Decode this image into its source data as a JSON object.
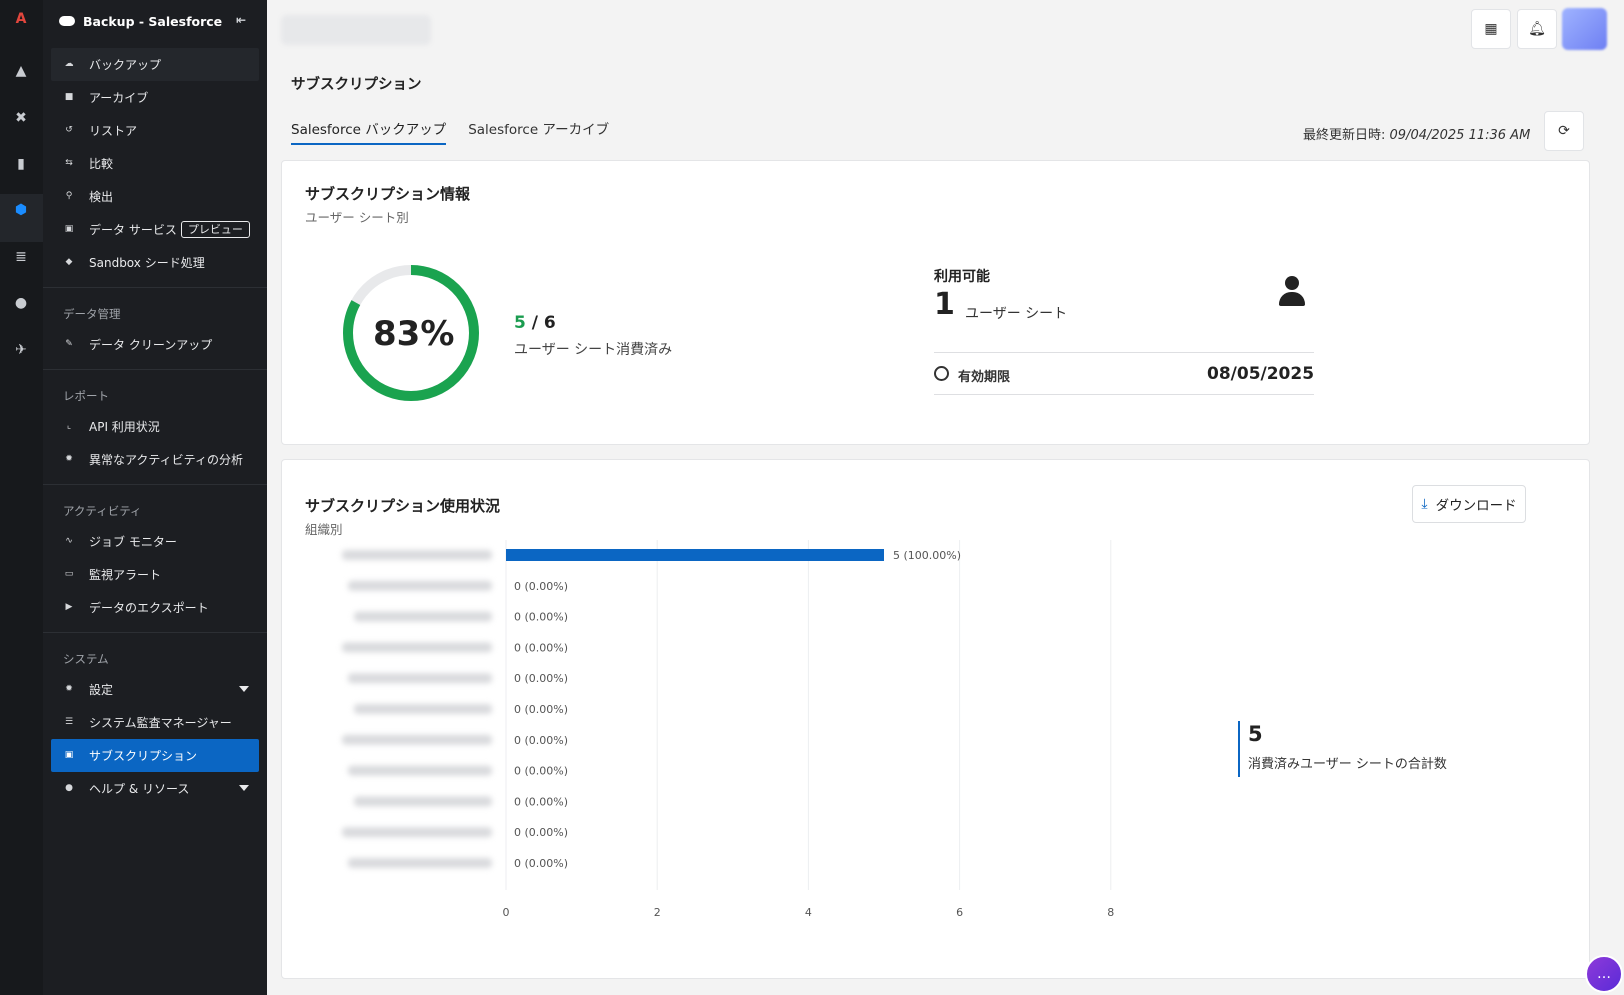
{
  "sidebar": {
    "header_title": "Backup - Salesforce",
    "items": [
      {
        "label": "バックアップ",
        "icon": "cloud-icon"
      },
      {
        "label": "アーカイブ",
        "icon": "archive-icon"
      },
      {
        "label": "リストア",
        "icon": "restore-icon"
      },
      {
        "label": "比較",
        "icon": "compare-icon"
      },
      {
        "label": "検出",
        "icon": "search-icon"
      },
      {
        "label": "データ サービス",
        "icon": "data-service-icon",
        "badge": "プレビュー"
      },
      {
        "label": "Sandbox シード処理",
        "icon": "sandbox-icon"
      }
    ],
    "sections": {
      "data_mgmt": {
        "title": "データ管理",
        "items": [
          {
            "label": "データ クリーンアップ"
          }
        ]
      },
      "reports": {
        "title": "レポート",
        "items": [
          {
            "label": "API 利用状況"
          },
          {
            "label": "異常なアクティビティの分析"
          }
        ]
      },
      "activity": {
        "title": "アクティビティ",
        "items": [
          {
            "label": "ジョブ モニター"
          },
          {
            "label": "監視アラート"
          },
          {
            "label": "データのエクスポート"
          }
        ]
      },
      "system": {
        "title": "システム",
        "items": [
          {
            "label": "設定"
          },
          {
            "label": "システム監査マネージャー"
          },
          {
            "label": "サブスクリプション"
          },
          {
            "label": "ヘルプ & リソース"
          }
        ]
      }
    }
  },
  "main": {
    "page_title": "サブスクリプション",
    "tabs": [
      {
        "label": "Salesforce バックアップ"
      },
      {
        "label": "Salesforce アーカイブ"
      }
    ],
    "last_updated_label": "最終更新日時: ",
    "last_updated_value": "09/04/2025 11:36 AM"
  },
  "info_card": {
    "title": "サブスクリプション情報",
    "subtitle": "ユーザー シート別",
    "percent_label": "83%",
    "percent_value": 83,
    "used": "5",
    "slash": " / ",
    "total": "6",
    "used_caption": "ユーザー シート消費済み",
    "available_title": "利用可能",
    "available_count": "1",
    "available_unit": "ユーザー シート",
    "expiry_label": "有効期限",
    "expiry_value": "08/05/2025"
  },
  "usage_card": {
    "title": "サブスクリプション使用状況",
    "subtitle": "組織別",
    "download_label": "ダウンロード",
    "total_value": "5",
    "total_caption": "消費済みユーザー シートの合計数"
  },
  "colors": {
    "accent": "#0b66c3",
    "green": "#1a9c4f",
    "bar": "#0b66c3"
  },
  "chart_data": {
    "type": "bar",
    "orientation": "horizontal",
    "categories": [
      "",
      "",
      "",
      "",
      "",
      "",
      "",
      "",
      "",
      "",
      ""
    ],
    "values": [
      5,
      0,
      0,
      0,
      0,
      0,
      0,
      0,
      0,
      0,
      0
    ],
    "data_labels": [
      "5 (100.00%)",
      "0 (0.00%)",
      "0 (0.00%)",
      "0 (0.00%)",
      "0 (0.00%)",
      "0 (0.00%)",
      "0 (0.00%)",
      "0 (0.00%)",
      "0 (0.00%)",
      "0 (0.00%)",
      "0 (0.00%)"
    ],
    "xlim": [
      0,
      8
    ],
    "xticks": [
      "0",
      "2",
      "4",
      "6",
      "8"
    ],
    "grid": true
  }
}
